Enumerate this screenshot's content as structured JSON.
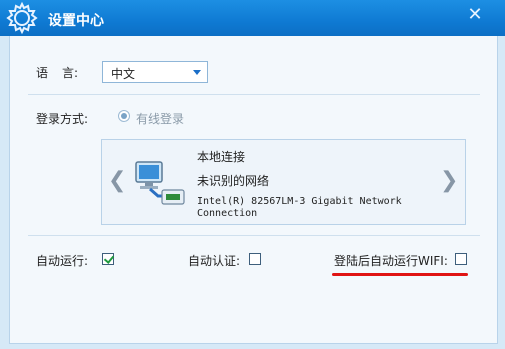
{
  "window": {
    "title": "设置中心",
    "close_label": "✕"
  },
  "language": {
    "label_part1": "语",
    "label_part2": "言:",
    "selected": "中文"
  },
  "login": {
    "label": "登录方式:",
    "option": "有线登录"
  },
  "connection": {
    "name": "本地连接",
    "network": "未识别的网络",
    "adapter": "Intel(R) 82567LM-3 Gigabit Network Connection"
  },
  "options": {
    "auto_run_label": "自动运行:",
    "auto_run_checked": true,
    "auto_auth_label": "自动认证:",
    "auto_auth_checked": false,
    "wifi_label": "登陆后自动运行WIFI:",
    "wifi_checked": false
  },
  "colors": {
    "titlebar": "#0f7ad3",
    "highlight_underline": "#e01414"
  }
}
